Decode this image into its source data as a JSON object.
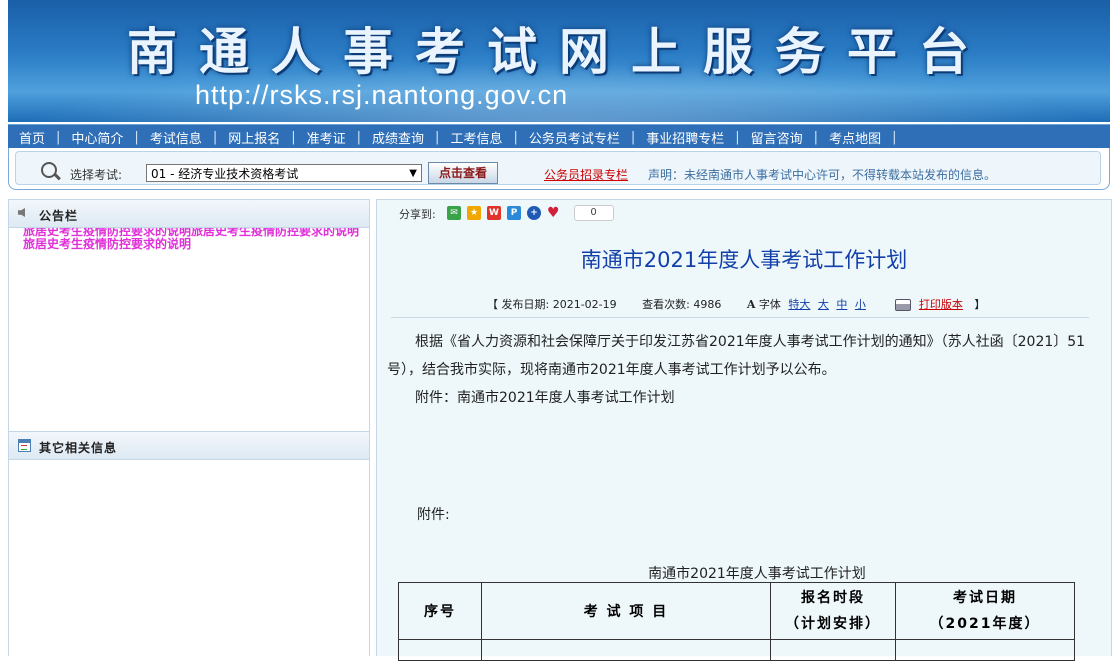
{
  "banner": {
    "title": "南通人事考试网上服务平台",
    "url": "http://rsks.rsj.nantong.gov.cn"
  },
  "nav": {
    "items": [
      "首页",
      "中心简介",
      "考试信息",
      "网上报名",
      "准考证",
      "成绩查询",
      "工考信息",
      "公务员考试专栏",
      "事业招聘专栏",
      "留言咨询",
      "考点地图"
    ]
  },
  "exam_select": {
    "label": "选择考试:",
    "selected": "01 - 经济专业技术资格考试",
    "button": "点击查看",
    "gwy_link": "公务员招录专栏",
    "notice": "声明：未经南通市人事考试中心许可，不得转载本站发布的信息。"
  },
  "sidebar": {
    "announcement_title": "公告栏",
    "announcement_line_clipped": "旅居史考生疫情防控要求的说明旅居史考生疫情防控要求的说明",
    "announcement_line": "旅居史考生疫情防控要求的说明",
    "other_title": "其它相关信息"
  },
  "article": {
    "share_label": "分享到:",
    "share_count": "0",
    "title": "南通市2021年度人事考试工作计划",
    "publish_label": "【 发布日期: 2021-02-19",
    "views_label": "查看次数: 4986",
    "font_label": "字体",
    "font_sizes": [
      "特大",
      "大",
      "中",
      "小"
    ],
    "print_label": "打印版本",
    "close_bracket": "】",
    "paragraph1": "根据《省人力资源和社会保障厅关于印发江苏省2021年度人事考试工作计划的通知》（苏人社函〔2021〕51号），结合我市实际，现将南通市2021年度人事考试工作计划予以公布。",
    "attachment_line": "附件：南通市2021年度人事考试工作计划",
    "attachment_label": "附件:",
    "table_caption": "南通市2021年度人事考试工作计划",
    "table_headers": {
      "no": "序号",
      "project": "考  试   项  目",
      "signup_1": "报名时段",
      "signup_2": "（计划安排）",
      "date_1": "考试日期",
      "date_2": "（2021年度）"
    }
  },
  "colors": {
    "nav_bg": "#2f6fb7",
    "title_blue": "#1340a8",
    "announcement_pink": "#e02fd9"
  }
}
